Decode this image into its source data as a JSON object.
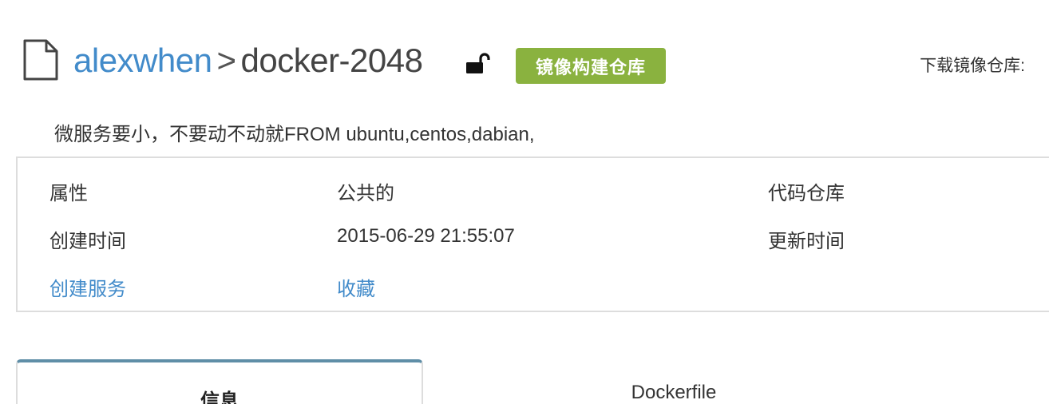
{
  "header": {
    "owner": "alexwhen",
    "separator": ">",
    "repo_name": "docker-2048",
    "badge_label": "镜像构建仓库",
    "download_label": "下载镜像仓库:",
    "icons": {
      "file": "file-icon",
      "lock": "unlock-icon"
    },
    "colors": {
      "link": "#428bca",
      "badge": "#8ab23f",
      "tab_accent": "#5f8ea7"
    }
  },
  "description": "微服务要小，不要动不动就FROM ubuntu,centos,dabian,",
  "info": {
    "row1": {
      "attribute_label": "属性",
      "attribute_value": "公共的",
      "code_repo_label": "代码仓库"
    },
    "row2": {
      "created_label": "创建时间",
      "created_value": "2015-06-29 21:55:07",
      "updated_label": "更新时间"
    },
    "row3": {
      "create_service_link": "创建服务",
      "favorite_link": "收藏"
    }
  },
  "tabs": [
    {
      "label": "信息",
      "active": true
    },
    {
      "label": "Dockerfile",
      "active": false
    }
  ]
}
